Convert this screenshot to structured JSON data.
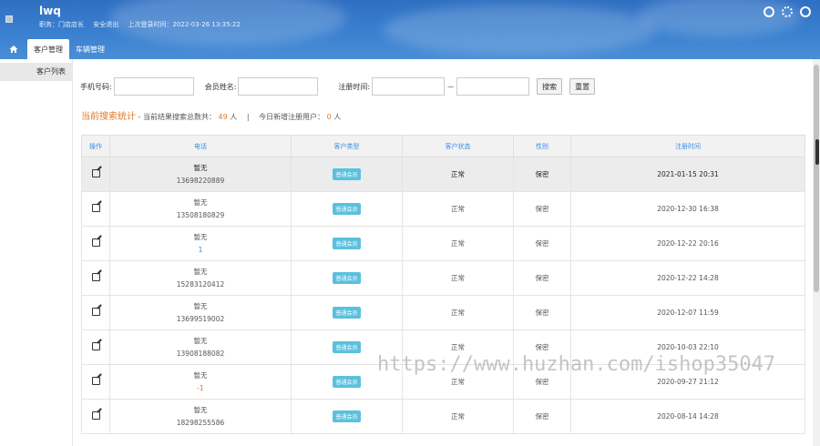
{
  "header": {
    "title": "lwq",
    "role": "职务：门店店长",
    "logout": "安全退出",
    "last_login": "上次登录时间：2022-03-26 13:35:22",
    "icons": [
      "help-icon",
      "gear-icon",
      "clock-icon"
    ]
  },
  "nav": {
    "tabs": [
      {
        "label": "客户管理",
        "active": true
      },
      {
        "label": "车辆管理",
        "active": false
      }
    ]
  },
  "sidebar": {
    "items": [
      {
        "label": "客户列表"
      }
    ]
  },
  "search": {
    "phone_label": "手机号码:",
    "name_label": "会员姓名:",
    "regtime_label": "注册时间:",
    "range_sep": "—",
    "search_btn": "搜索",
    "reset_btn": "重置"
  },
  "stats": {
    "title": "当前搜索统计",
    "text1": "- 当前结果搜索总数共：",
    "total": "49",
    "unit": "人",
    "sep": "|",
    "text2": "今日新增注册用户：",
    "today": "0",
    "unit2": "人"
  },
  "table": {
    "headers": [
      "操作",
      "电话",
      "客户类型",
      "客户状态",
      "性别",
      "注册时间"
    ],
    "rows": [
      {
        "name": "暂无",
        "phone": "13698220889",
        "type": "普通会员",
        "status": "正常",
        "gender": "保密",
        "time": "2021-01-15 20:31"
      },
      {
        "name": "暂无",
        "phone": "13508180829",
        "type": "普通会员",
        "status": "正常",
        "gender": "保密",
        "time": "2020-12-30 16:38"
      },
      {
        "name": "暂无",
        "phone": "1",
        "type": "普通会员",
        "status": "正常",
        "gender": "保密",
        "time": "2020-12-22 20:16"
      },
      {
        "name": "暂无",
        "phone": "15283120412",
        "type": "普通会员",
        "status": "正常",
        "gender": "保密",
        "time": "2020-12-22 14:28"
      },
      {
        "name": "暂无",
        "phone": "13699519002",
        "type": "普通会员",
        "status": "正常",
        "gender": "保密",
        "time": "2020-12-07 11:59"
      },
      {
        "name": "暂无",
        "phone": "13908188082",
        "type": "普通会员",
        "status": "正常",
        "gender": "保密",
        "time": "2020-10-03 22:10"
      },
      {
        "name": "暂无",
        "phone": "-1",
        "type": "普通会员",
        "status": "正常",
        "gender": "保密",
        "time": "2020-09-27 21:12"
      },
      {
        "name": "暂无",
        "phone": "18298255586",
        "type": "普通会员",
        "status": "正常",
        "gender": "保密",
        "time": "2020-08-14 14:28"
      }
    ]
  },
  "watermark": "https://www.huzhan.com/ishop35047",
  "colors": {
    "header": "#3a80d0",
    "accent": "#3a8ee6",
    "highlight": "#e07a2b",
    "badge": "#5bc0de"
  }
}
